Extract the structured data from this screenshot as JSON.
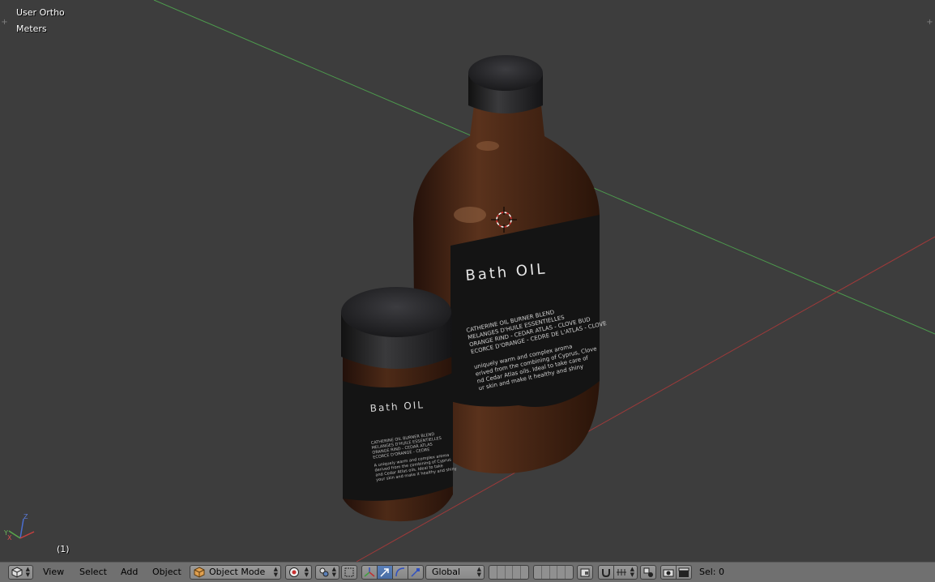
{
  "viewport": {
    "view_name": "User Ortho",
    "units": "Meters",
    "frame": "(1)"
  },
  "product_large": {
    "title": "Bath OIL",
    "text_lines": [
      "CATHERINE OIL BURNER BLEND",
      "MELANGES D'HUILE ESSENTIELLES",
      "ORANGE RIND - CEDAR ATLAS - CLOVE BUD",
      "ECORCE D'ORANGE - CEDRE DE L'ATLAS - CLOVE",
      "uniquely warm and complex aroma",
      "erived from the combining of Cyprus, Clove",
      "nd Cedar Atlas oils. Ideal to take care of",
      "ur skin and make it healthy and shiny"
    ]
  },
  "product_small": {
    "title": "Bath OIL",
    "text_lines": [
      "CATHERINE OIL BURNER BLEND",
      "MELANGES D'HUILE ESSENTIELLES",
      "ORANGE RIND - CEDAR ATLAS",
      "ECORCE D'ORANGE - CEDRE",
      "A uniquely warm and complex aroma",
      "derived from the combining of Cyprus",
      "and Cedar Atlas oils. Ideal to take",
      "your skin and make it healthy and shiny"
    ]
  },
  "axis_gizmo": {
    "x": "X",
    "y": "Y",
    "z": "Z"
  },
  "header": {
    "menu_view": "View",
    "menu_select": "Select",
    "menu_add": "Add",
    "menu_object": "Object",
    "mode": "Object Mode",
    "orientation": "Global",
    "selection": "Sel: 0"
  },
  "colors": {
    "background": "#3d3d3d",
    "x_axis": "#9e3a3a",
    "y_axis": "#4d9a4d",
    "bottle": "#3b1f11",
    "cap": "#1c1c1e",
    "label": "#141414",
    "header": "#707070",
    "active_button": "#5a7fb8"
  },
  "icons": {
    "editor_type": "cube-icon",
    "mode_icon": "object-cube-icon",
    "pivot": "pivot-icon",
    "snap": "magnet-icon",
    "render": "camera-icon"
  }
}
